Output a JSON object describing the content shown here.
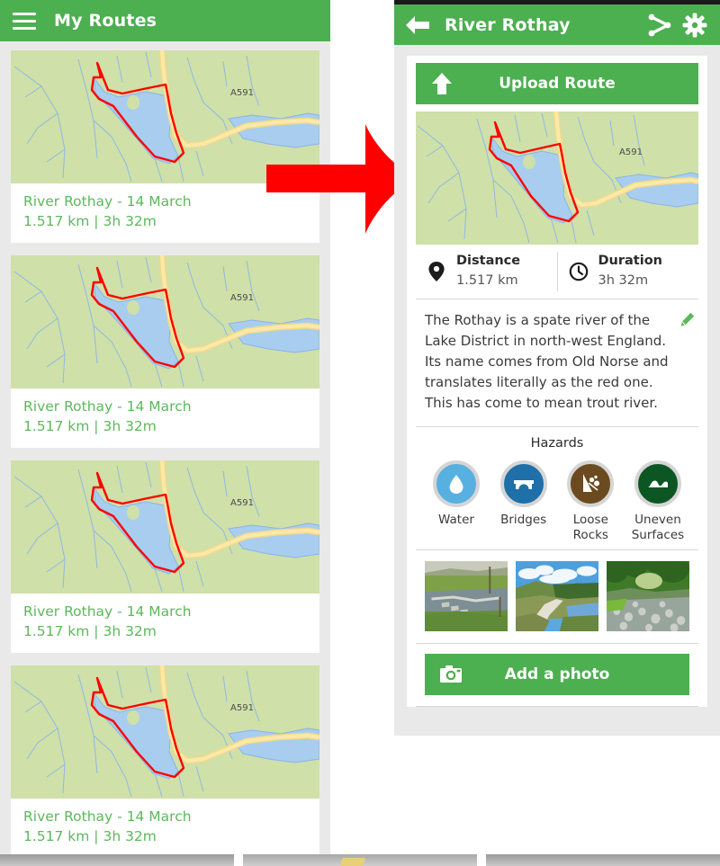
{
  "left_panel": {
    "menu_icon": "hamburger-icon",
    "title": "My Routes",
    "routes": [
      {
        "name": "River Rothay - 14 March",
        "stats": "1.517 km | 3h 32m"
      },
      {
        "name": "River Rothay - 14 March",
        "stats": "1.517 km | 3h 32m"
      },
      {
        "name": "River Rothay - 14 March",
        "stats": "1.517 km | 3h 32m"
      },
      {
        "name": "River Rothay - 14 March",
        "stats": "1.517 km | 3h 32m"
      }
    ]
  },
  "arrow": {
    "direction": "right",
    "color": "#ff0000"
  },
  "right_panel": {
    "header": {
      "back_icon": "back-arrow-icon",
      "title": "River Rothay",
      "share_icon": "share-icon",
      "settings_icon": "gear-icon"
    },
    "upload_button": {
      "label": "Upload Route",
      "icon": "upload-arrow-icon"
    },
    "map": {
      "road_label": "A591"
    },
    "stats": [
      {
        "icon": "map-pin-icon",
        "label": "Distance",
        "value": "1.517 km"
      },
      {
        "icon": "clock-icon",
        "label": "Duration",
        "value": "3h 32m"
      }
    ],
    "description": {
      "text": "The Rothay is a spate river of the Lake District in north-west England. Its name comes from Old Norse and translates literally as the red one. This has come to mean trout river.",
      "edit_icon": "pencil-icon"
    },
    "hazards": {
      "title": "Hazards",
      "items": [
        {
          "label": "Water",
          "icon": "water-drop-icon",
          "color": "#57b0e0"
        },
        {
          "label": "Bridges",
          "icon": "bridge-icon",
          "color": "#1f6fa8"
        },
        {
          "label": "Loose Rocks",
          "icon": "rockfall-icon",
          "color": "#6b4a20"
        },
        {
          "label": "Uneven Surfaces",
          "icon": "bumps-icon",
          "color": "#0c5623"
        }
      ]
    },
    "photos": [
      {
        "caption": "stepping-stones-river-photo"
      },
      {
        "caption": "riverside-path-photo"
      },
      {
        "caption": "rocky-riverbed-photo"
      }
    ],
    "add_photo_button": {
      "label": "Add a photo",
      "icon": "camera-icon"
    }
  },
  "colors": {
    "brand_green": "#4caf50",
    "text_green": "#5cb85c",
    "page_grey": "#e9e9e9",
    "arrow_red": "#ff0000"
  }
}
